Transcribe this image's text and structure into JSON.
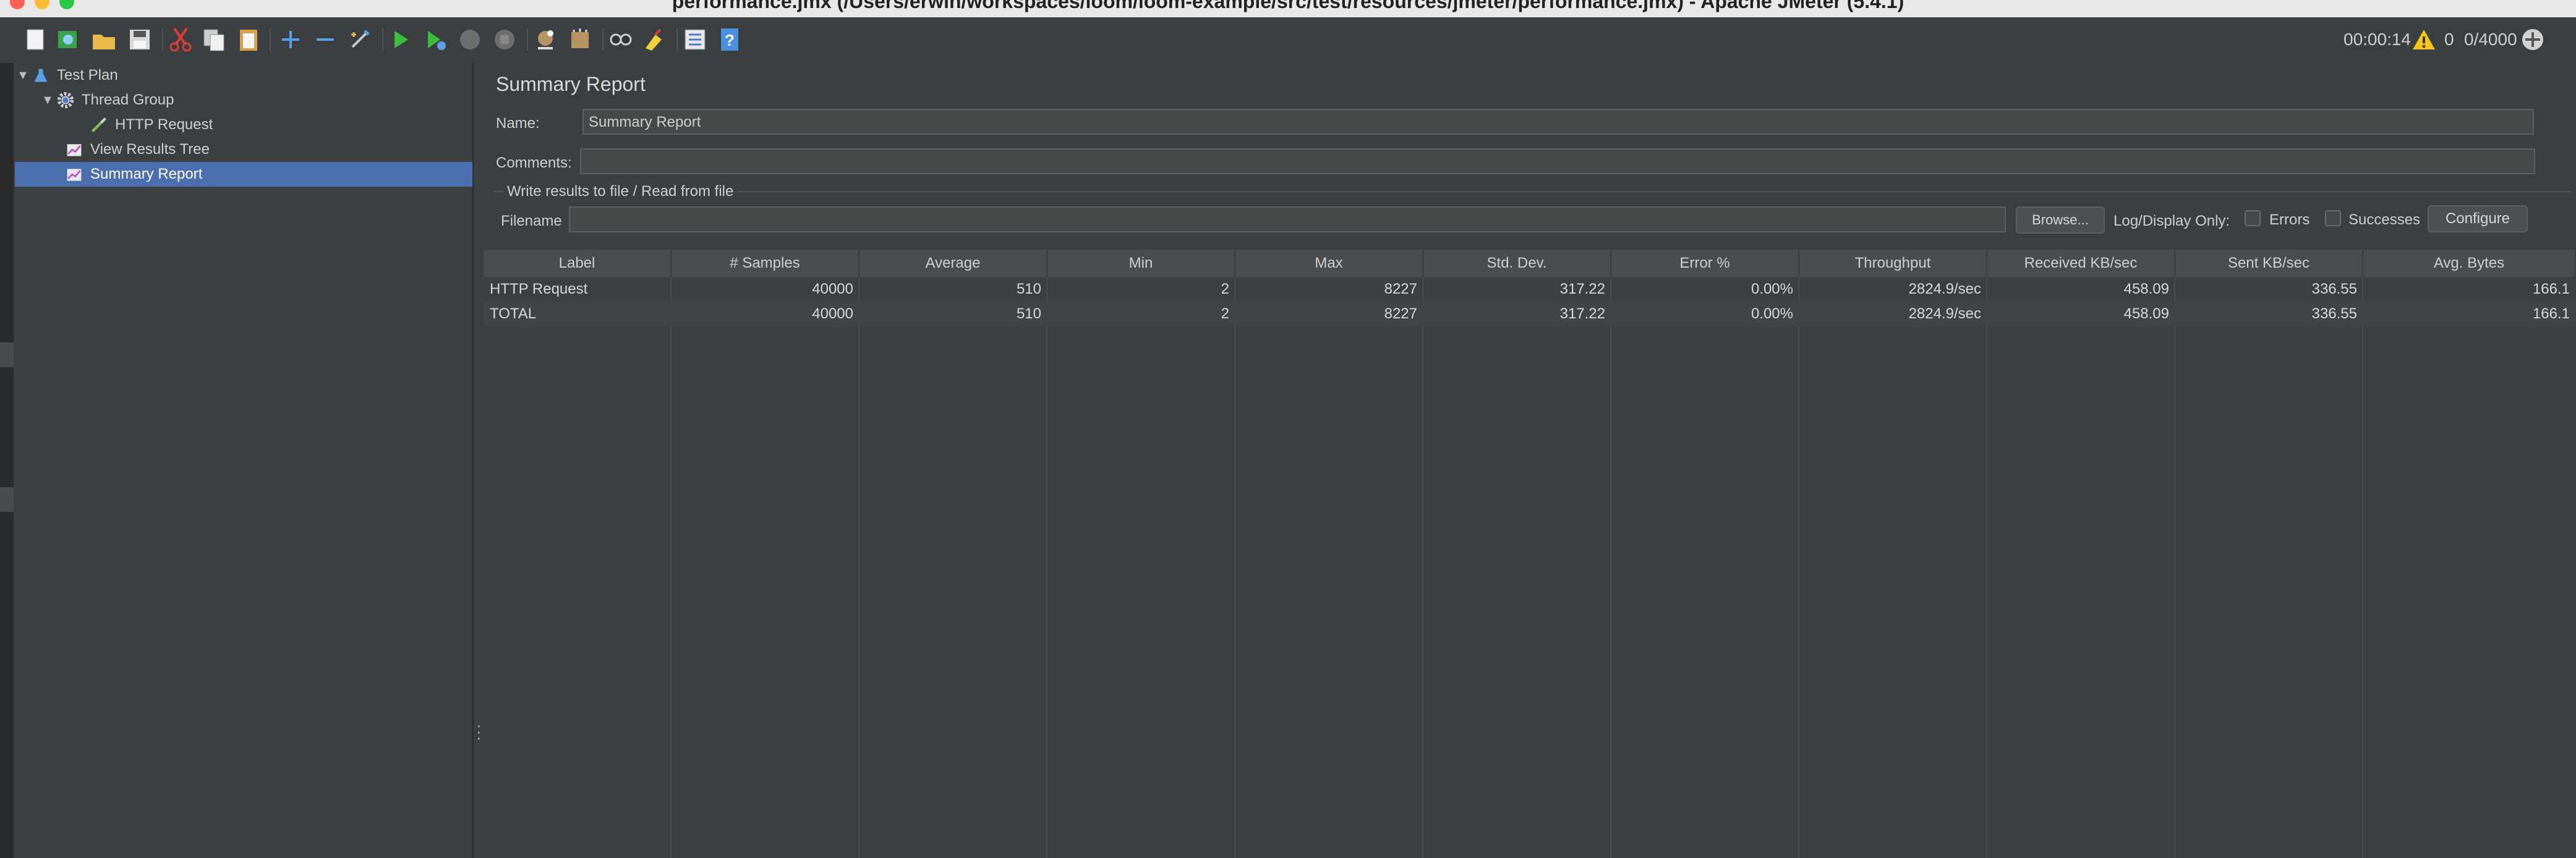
{
  "window": {
    "title": "performance.jmx (/Users/erwin/workspaces/loom/loom-example/src/test/resources/jmeter/performance.jmx) - Apache JMeter (5.4.1)"
  },
  "toolbar": {
    "buttons": [
      "new-icon",
      "templates-icon",
      "open-icon",
      "save-icon",
      "cut-icon",
      "copy-icon",
      "paste-icon",
      "expand-icon",
      "collapse-icon",
      "toggle-icon",
      "start-icon",
      "start-no-pauses-icon",
      "stop-icon",
      "shutdown-icon",
      "clear-icon",
      "clear-all-icon",
      "search-icon",
      "reset-search-icon",
      "function-helper-icon",
      "help-icon"
    ],
    "elapsed": "00:00:14",
    "warning_count": "0",
    "active_threads": "0/4000"
  },
  "tree": {
    "items": [
      {
        "label": "Test Plan",
        "icon": "test-plan-icon",
        "level": 0,
        "expanded": true,
        "selected": false
      },
      {
        "label": "Thread Group",
        "icon": "gear-icon",
        "level": 1,
        "expanded": true,
        "selected": false
      },
      {
        "label": "HTTP Request",
        "icon": "pipette-icon",
        "level": 2,
        "expanded": false,
        "selected": false
      },
      {
        "label": "View Results Tree",
        "icon": "chart-icon",
        "level": 1,
        "expanded": false,
        "selected": false
      },
      {
        "label": "Summary Report",
        "icon": "chart-icon",
        "level": 1,
        "expanded": false,
        "selected": true
      }
    ]
  },
  "panel": {
    "title": "Summary Report",
    "name_label": "Name:",
    "name_value": "Summary Report",
    "comments_label": "Comments:",
    "comments_value": "",
    "file_group_title": "Write results to file / Read from file",
    "filename_label": "Filename",
    "filename_value": "",
    "browse_label": "Browse...",
    "log_display_label": "Log/Display Only:",
    "errors_label": "Errors",
    "successes_label": "Successes",
    "configure_label": "Configure"
  },
  "table": {
    "columns": [
      "Label",
      "# Samples",
      "Average",
      "Min",
      "Max",
      "Std. Dev.",
      "Error %",
      "Throughput",
      "Received KB/sec",
      "Sent KB/sec",
      "Avg. Bytes"
    ],
    "rows": [
      [
        "HTTP Request",
        "40000",
        "510",
        "2",
        "8227",
        "317.22",
        "0.00%",
        "2824.9/sec",
        "458.09",
        "336.55",
        "166.1"
      ],
      [
        "TOTAL",
        "40000",
        "510",
        "2",
        "8227",
        "317.22",
        "0.00%",
        "2824.9/sec",
        "458.09",
        "336.55",
        "166.1"
      ]
    ]
  },
  "colors": {
    "background": "#3c3f41",
    "selection": "#4b6eaf",
    "header": "#4a4d50",
    "warning": "#f5c518"
  }
}
